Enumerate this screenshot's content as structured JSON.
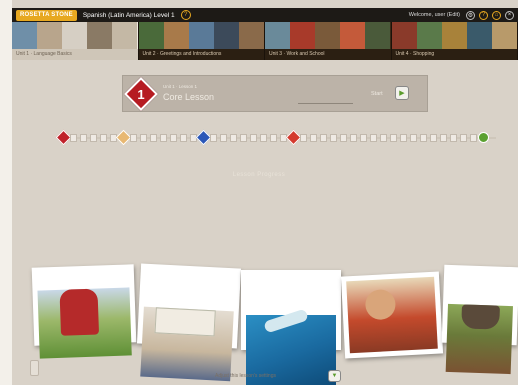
{
  "topbar": {
    "logo_text": "ROSETTA STONE",
    "course_title": "Spanish (Latin America) Level 1",
    "help_symbol": "?",
    "welcome_text": "Welcome, user (Edit)",
    "icons": [
      "settings-icon",
      "help-circle-icon",
      "home-icon",
      "exit-icon"
    ]
  },
  "units": [
    {
      "label": "Unit 1 · Language Basics",
      "active": true,
      "colors": [
        "#6f8fa8",
        "#b8a58c",
        "#d6cfc4",
        "#8a7a65",
        "#c4b8a5"
      ]
    },
    {
      "label": "Unit 2 · Greetings and Introductions",
      "active": false,
      "colors": [
        "#4a6a3a",
        "#a87a4a",
        "#5a7a98",
        "#3c4a5a",
        "#8a6a4a"
      ]
    },
    {
      "label": "Unit 3 · Work and School",
      "active": false,
      "colors": [
        "#6a8a9a",
        "#a83a2a",
        "#7a5a3a",
        "#c45a3a",
        "#4a5a3a"
      ]
    },
    {
      "label": "Unit 4 · Shopping",
      "active": false,
      "colors": [
        "#8a3a2a",
        "#5a7a4a",
        "#a8823a",
        "#3a5a6a",
        "#b89a6a"
      ]
    }
  ],
  "lesson": {
    "number": "1",
    "subtitle": "Unit 1 · Lesson 1",
    "title": "Core Lesson",
    "action_label": "Start"
  },
  "track": {
    "squares_count": 37,
    "markers": [
      {
        "type": "diamond",
        "color": "#c0222b",
        "index": 0
      },
      {
        "type": "diamond",
        "color": "#e8b872",
        "index": 6
      },
      {
        "type": "diamond",
        "color": "#2a57b8",
        "index": 14
      },
      {
        "type": "diamond",
        "color": "#d43a2e",
        "index": 23
      },
      {
        "type": "circle",
        "color": "#5aa030",
        "index": 42
      }
    ]
  },
  "center_caption": "Lesson Progress",
  "photos": [
    {
      "name": "girl-in-field-photo",
      "colors": [
        "#6fa040",
        "#b23030",
        "#d9b890"
      ]
    },
    {
      "name": "kids-reading-photo",
      "colors": [
        "#d8d0c0",
        "#3a4a6a",
        "#c98a6a"
      ]
    },
    {
      "name": "scuba-diver-photo",
      "colors": [
        "#1b6fa8",
        "#4ab0d0",
        "#c0d8e0"
      ]
    },
    {
      "name": "couple-photo",
      "colors": [
        "#b83a24",
        "#d86a3a",
        "#8a5a3a"
      ]
    },
    {
      "name": "cooking-photo",
      "colors": [
        "#6a8a3a",
        "#8a5a3a",
        "#c48a4a"
      ]
    }
  ],
  "bottom": {
    "caption": "Adjust this lesson's settings",
    "button_symbol": "▼"
  }
}
